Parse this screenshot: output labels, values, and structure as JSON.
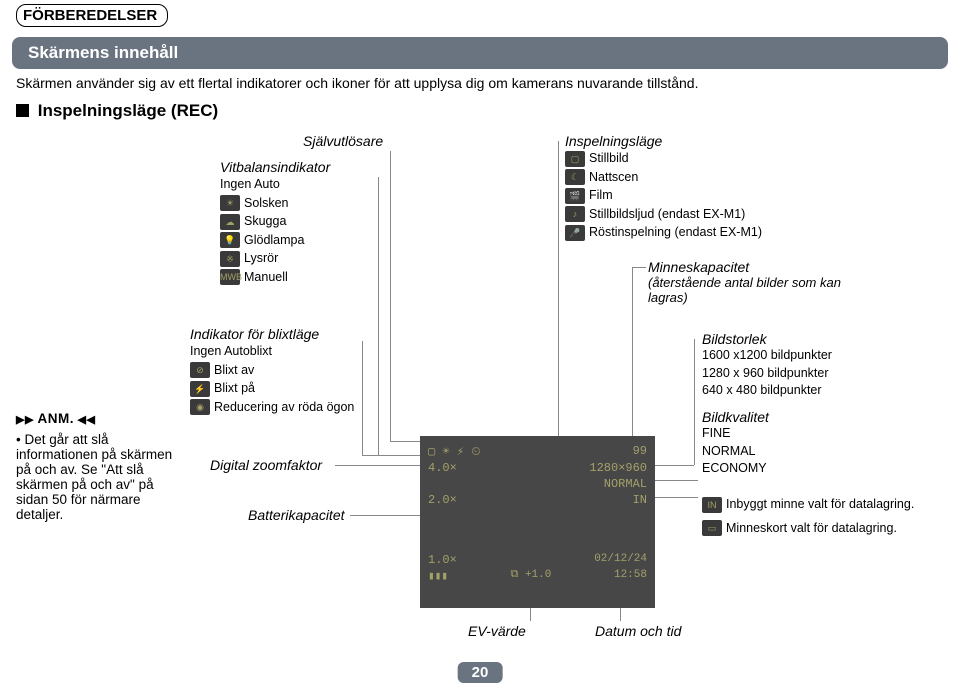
{
  "page": {
    "top_heading": "FÖRBEREDELSER",
    "section_title": "Skärmens innehåll",
    "intro": "Skärmen använder sig av ett flertal indikatorer och ikoner för att upplysa dig om kamerans nuvarande tillstånd.",
    "sub_heading": "Inspelningsläge (REC)",
    "page_number": "20"
  },
  "note": {
    "heading": "ANM.",
    "body": "• Det går att slå informationen på skärmen på och av. Se \"Att slå skärmen på och av\" på sidan 50 för närmare detaljer."
  },
  "self_timer_label": "Självutlösare",
  "white_balance": {
    "title": "Vitbalansindikator",
    "items": [
      "Ingen  Auto",
      "Solsken",
      "Skugga",
      "Glödlampa",
      "Lysrör",
      "Manuell"
    ],
    "icon_text": [
      "",
      "☀",
      "☁",
      "💡",
      "※",
      "MWB"
    ]
  },
  "flash": {
    "title": "Indikator för blixtläge",
    "items": [
      "Ingen  Autoblixt",
      "Blixt av",
      "Blixt på",
      "Reducering av röda ögon"
    ],
    "icon_text": [
      "",
      "⊘",
      "⚡",
      "◉"
    ]
  },
  "digital_zoom": "Digital zoomfaktor",
  "battery": "Batterikapacitet",
  "ev_value": "EV-värde",
  "rec_mode": {
    "title": "Inspelningsläge",
    "items": [
      "Stillbild",
      "Nattscen",
      "Film",
      "Stillbildsljud (endast EX-M1)",
      "Röstinspelning (endast EX-M1)"
    ],
    "icon_text": [
      "▢",
      "☾",
      "🎬",
      "♪",
      "🎤"
    ]
  },
  "memory_capacity": {
    "title": "Minneskapacitet",
    "subtitle": "(återstående antal bilder som kan lagras)"
  },
  "image_size": {
    "title": "Bildstorlek",
    "items": [
      "1600 x1200 bildpunkter",
      "1280 x  960 bildpunkter",
      "640 x  480 bildpunkter"
    ]
  },
  "quality": {
    "title": "Bildkvalitet",
    "items": [
      "FINE",
      "NORMAL",
      "ECONOMY"
    ]
  },
  "storage": {
    "in_label": "Inbyggt minne valt för datalagring.",
    "card_label": "Minneskort valt för datalagring."
  },
  "datetime": "Datum och tid",
  "lcd": {
    "counter": "99",
    "res": "1280×960",
    "quality": "NORMAL",
    "zoom1": "4.0×",
    "zoom2": "2.0×",
    "zoom3": "1.0×",
    "ev": "+1.0",
    "date": "02/12/24",
    "time": "12:58",
    "evlabel": "EV"
  }
}
